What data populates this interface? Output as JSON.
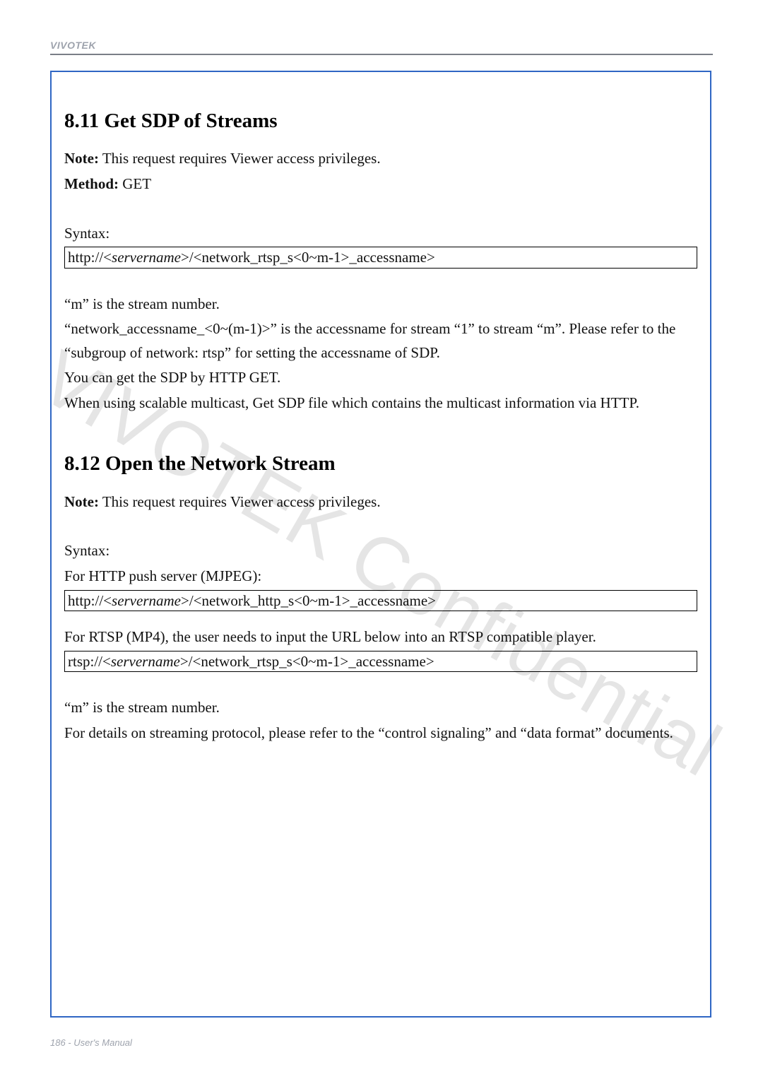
{
  "header": {
    "brand": "VIVOTEK"
  },
  "watermark": "VIVOTEK Confidential",
  "footer": "186 - User's Manual",
  "s811": {
    "title": "8.11 Get SDP of Streams",
    "note_label": "Note:",
    "note_text": " This request requires Viewer access privileges.",
    "method_label": "Method:",
    "method_value": " GET",
    "syntax_label": "Syntax:",
    "code_pre": "http://<",
    "code_srv": "servername",
    "code_post": ">/<network_rtsp_s<0~m-1>_accessname>",
    "p1": "“m” is the stream number.",
    "p2": "“network_accessname_<0~(m-1)>” is the accessname for stream “1” to stream “m”. Please refer to the “subgroup of network: rtsp” for setting the accessname of SDP.",
    "p3": "You can get the SDP by HTTP GET.",
    "p4": "When using scalable multicast, Get SDP file which contains the multicast information via HTTP."
  },
  "s812": {
    "title": "8.12 Open the Network Stream",
    "note_label": "Note:",
    "note_text": " This request requires Viewer access privileges.",
    "syntax_label": "Syntax:",
    "http_label": "For HTTP push server (MJPEG):",
    "http_code_pre": "http://<",
    "http_code_srv": "servername",
    "http_code_post": ">/<network_http_s<0~m-1>_accessname>",
    "rtsp_label": "For RTSP (MP4), the user needs to input the URL below into an RTSP compatible player.",
    "rtsp_code_pre": "rtsp://<",
    "rtsp_code_srv": "servername",
    "rtsp_code_post": ">/<network_rtsp_s<0~m-1>_accessname>",
    "p1": "“m” is the stream number.",
    "p2": "For details on streaming protocol, please refer to the “control signaling” and “data format” documents."
  }
}
